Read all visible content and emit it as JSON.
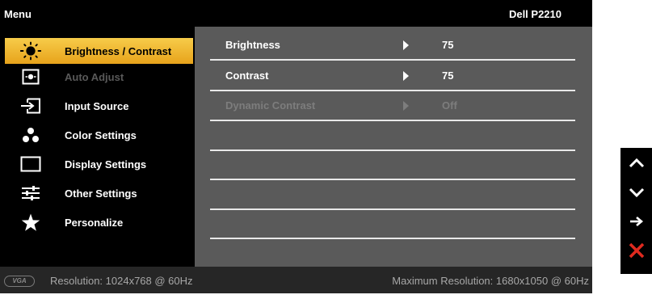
{
  "header": {
    "menu_title": "Menu",
    "model": "Dell P2210"
  },
  "sidebar": {
    "items": [
      {
        "label": "Brightness / Contrast",
        "icon": "brightness-icon",
        "selected": true,
        "disabled": false
      },
      {
        "label": "Auto Adjust",
        "icon": "auto-adjust-icon",
        "selected": false,
        "disabled": true
      },
      {
        "label": "Input Source",
        "icon": "input-source-icon",
        "selected": false,
        "disabled": false
      },
      {
        "label": "Color Settings",
        "icon": "color-settings-icon",
        "selected": false,
        "disabled": false
      },
      {
        "label": "Display Settings",
        "icon": "display-settings-icon",
        "selected": false,
        "disabled": false
      },
      {
        "label": "Other Settings",
        "icon": "other-settings-icon",
        "selected": false,
        "disabled": false
      },
      {
        "label": "Personalize",
        "icon": "star-icon",
        "selected": false,
        "disabled": false
      }
    ]
  },
  "main": {
    "rows": [
      {
        "name": "Brightness",
        "value": "75",
        "disabled": false
      },
      {
        "name": "Contrast",
        "value": "75",
        "disabled": false
      },
      {
        "name": "Dynamic Contrast",
        "value": "Off",
        "disabled": true
      }
    ]
  },
  "status": {
    "connector": "VGA",
    "resolution": "Resolution: 1024x768 @ 60Hz",
    "max_resolution": "Maximum Resolution: 1680x1050 @ 60Hz"
  },
  "buttons": [
    {
      "icon": "arrow-up-icon"
    },
    {
      "icon": "arrow-down-icon"
    },
    {
      "icon": "arrow-right-icon"
    },
    {
      "icon": "close-x-icon"
    }
  ],
  "colors": {
    "selected_gradient_top": "#f7cc4a",
    "selected_gradient_bottom": "#e7a31b",
    "panel_gray": "#5a5a5a",
    "close_red": "#e02a1f"
  }
}
